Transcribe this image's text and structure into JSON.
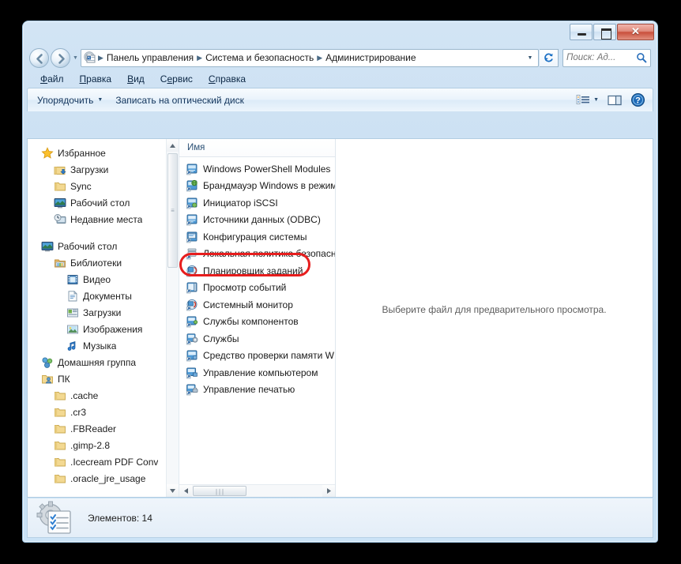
{
  "window": {
    "title": "",
    "buttons": {
      "minimize": "minimize-button",
      "maximize": "maximize-button",
      "close_label": "✕"
    }
  },
  "address_bar": {
    "back_tooltip": "Назад",
    "forward_tooltip": "Вперед",
    "breadcrumbs": [
      "Панель управления",
      "Система и безопасность",
      "Администрирование"
    ],
    "separator": "▶",
    "caret": "▼"
  },
  "search": {
    "placeholder": "Поиск: Ад...",
    "value": ""
  },
  "menu": {
    "items": [
      {
        "pre": "",
        "u": "Ф",
        "post": "айл"
      },
      {
        "pre": "",
        "u": "П",
        "post": "равка"
      },
      {
        "pre": "",
        "u": "В",
        "post": "ид"
      },
      {
        "pre": "С",
        "u": "е",
        "post": "рвис"
      },
      {
        "pre": "",
        "u": "С",
        "post": "правка"
      }
    ]
  },
  "toolbar": {
    "organize_label": "Упорядочить",
    "organize_caret": "▼",
    "burn_label": "Записать на оптический диск",
    "view_caret": "▼"
  },
  "navigation_pane": {
    "items": [
      {
        "label": "Избранное",
        "icon": "star-icon",
        "level": 0
      },
      {
        "label": "Загрузки",
        "icon": "folder-download-icon",
        "level": 1
      },
      {
        "label": "Sync",
        "icon": "folder-icon",
        "level": 1
      },
      {
        "label": "Рабочий стол",
        "icon": "desktop-icon",
        "level": 1
      },
      {
        "label": "Недавние места",
        "icon": "recent-places-icon",
        "level": 1
      },
      {
        "label": "__spacer__",
        "icon": "",
        "level": 0
      },
      {
        "label": "Рабочий стол",
        "icon": "desktop-icon",
        "level": 0
      },
      {
        "label": "Библиотеки",
        "icon": "libraries-icon",
        "level": 1
      },
      {
        "label": "Видео",
        "icon": "video-library-icon",
        "level": 2
      },
      {
        "label": "Документы",
        "icon": "documents-library-icon",
        "level": 2
      },
      {
        "label": "Загрузки",
        "icon": "downloads-library-icon",
        "level": 2
      },
      {
        "label": "Изображения",
        "icon": "pictures-library-icon",
        "level": 2
      },
      {
        "label": "Музыка",
        "icon": "music-library-icon",
        "level": 2
      },
      {
        "label": "Домашняя группа",
        "icon": "homegroup-icon",
        "level": 0
      },
      {
        "label": "ПК",
        "icon": "user-folder-icon",
        "level": 0
      },
      {
        "label": ".cache",
        "icon": "folder-icon",
        "level": 1
      },
      {
        "label": ".cr3",
        "icon": "folder-icon",
        "level": 1
      },
      {
        "label": ".FBReader",
        "icon": "folder-icon",
        "level": 1
      },
      {
        "label": ".gimp-2.8",
        "icon": "folder-icon",
        "level": 1
      },
      {
        "label": ".Icecream PDF Conv",
        "icon": "folder-icon",
        "level": 1
      },
      {
        "label": ".oracle_jre_usage",
        "icon": "folder-icon",
        "level": 1
      }
    ],
    "scrollbar": {
      "up_arrow": "▲",
      "down_arrow": "▼",
      "grip": "≡"
    }
  },
  "file_list": {
    "column_header": "Имя",
    "items": [
      {
        "name": "Windows PowerShell Modules",
        "icon": "shortcut-icon"
      },
      {
        "name": "Брандмауэр Windows в режим",
        "icon": "shortcut-globe-icon"
      },
      {
        "name": "Инициатор iSCSI",
        "icon": "shortcut-network-icon"
      },
      {
        "name": "Источники данных (ODBC)",
        "icon": "shortcut-icon"
      },
      {
        "name": "Конфигурация системы",
        "icon": "shortcut-icon"
      },
      {
        "name": "Локальная политика безопасн",
        "icon": "shortcut-policy-icon"
      },
      {
        "name": "Планировщик заданий",
        "icon": "shortcut-scheduler-icon",
        "highlighted": true
      },
      {
        "name": "Просмотр событий",
        "icon": "shortcut-eventlog-icon"
      },
      {
        "name": "Системный монитор",
        "icon": "shortcut-perfmon-icon"
      },
      {
        "name": "Службы компонентов",
        "icon": "shortcut-components-icon"
      },
      {
        "name": "Службы",
        "icon": "shortcut-services-icon"
      },
      {
        "name": "Средство проверки памяти W",
        "icon": "shortcut-memory-icon"
      },
      {
        "name": "Управление компьютером",
        "icon": "shortcut-compmgmt-icon"
      },
      {
        "name": "Управление печатью",
        "icon": "shortcut-printmgmt-icon"
      }
    ],
    "hscrollbar": {
      "left_arrow": "◀",
      "right_arrow": "▶",
      "grip": "∣∣∣"
    }
  },
  "preview_pane": {
    "message": "Выберите файл для предварительного просмотра."
  },
  "status_bar": {
    "text": "Элементов: 14",
    "icon": "administrative-tools-icon"
  },
  "colors": {
    "frame": "#c9dff2",
    "accent_red": "#e71d1d",
    "close_button": "#c9503c",
    "link_blue": "#13355c"
  }
}
